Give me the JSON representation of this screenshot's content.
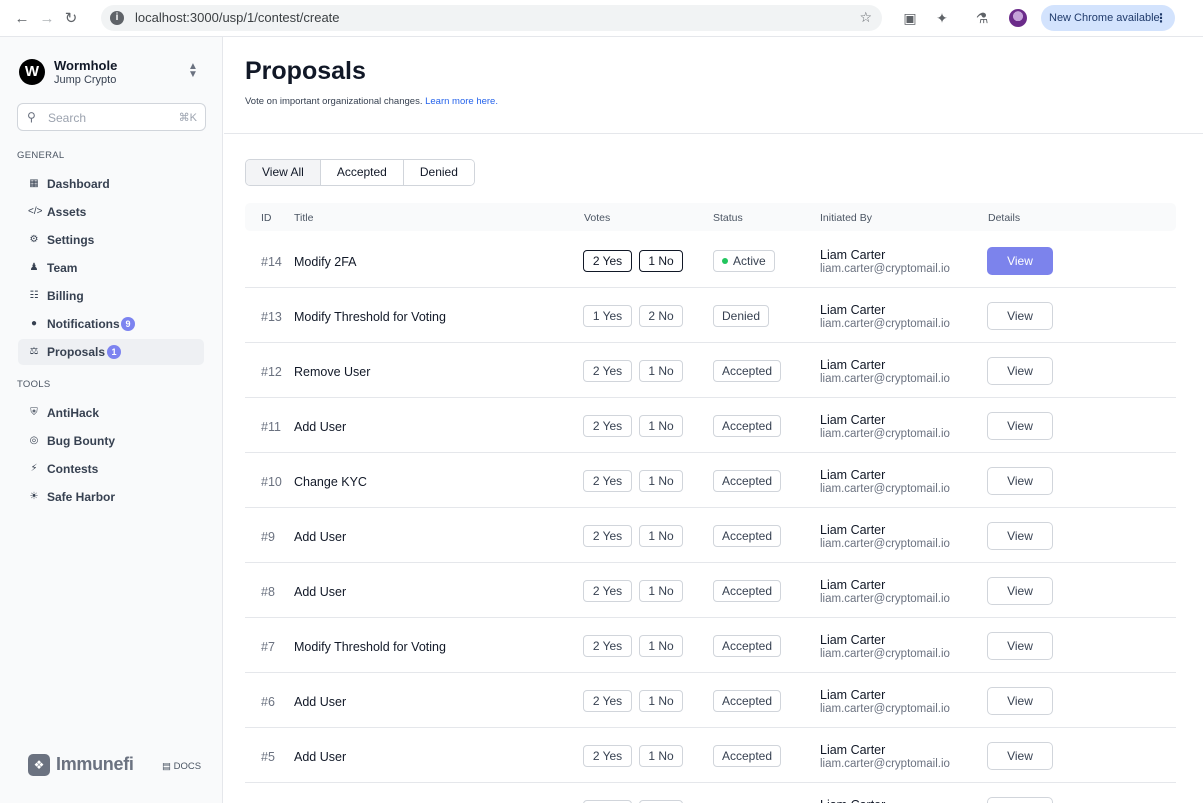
{
  "browser": {
    "url": "localhost:3000/usp/1/contest/create",
    "update_label": "New Chrome available",
    "icons": [
      "back-icon",
      "forward-icon",
      "reload-icon",
      "info-icon",
      "star-icon",
      "cast-icon",
      "extensions-icon",
      "labs-icon",
      "profile-avatar"
    ]
  },
  "org": {
    "logo_letter": "W",
    "name": "Wormhole",
    "subtitle": "Jump Crypto"
  },
  "search": {
    "placeholder": "Search",
    "shortcut": "⌘K"
  },
  "sidebar": {
    "general_label": "GENERAL",
    "tools_label": "TOOLS",
    "general_items": [
      {
        "label": "Dashboard",
        "icon": "grid-icon"
      },
      {
        "label": "Assets",
        "icon": "code-icon"
      },
      {
        "label": "Settings",
        "icon": "gear-icon"
      },
      {
        "label": "Team",
        "icon": "team-icon"
      },
      {
        "label": "Billing",
        "icon": "billing-icon"
      },
      {
        "label": "Notifications",
        "icon": "bell-icon",
        "badge": "9"
      },
      {
        "label": "Proposals",
        "icon": "scale-icon",
        "badge": "1"
      }
    ],
    "tool_items": [
      {
        "label": "AntiHack",
        "icon": "shield-icon"
      },
      {
        "label": "Bug Bounty",
        "icon": "globe-icon"
      },
      {
        "label": "Contests",
        "icon": "bolt-icon"
      },
      {
        "label": "Safe Harbor",
        "icon": "sun-icon"
      }
    ],
    "brand": "Immunefi",
    "docs": "DOCS"
  },
  "page": {
    "title": "Proposals",
    "subtitle": "Vote on important organizational changes.",
    "learn_more": "Learn more here."
  },
  "tabs": [
    "View All",
    "Accepted",
    "Denied"
  ],
  "table": {
    "headers": [
      "ID",
      "Title",
      "Votes",
      "Status",
      "Initiated By",
      "Details"
    ],
    "rows": [
      {
        "id": "#14",
        "title": "Modify 2FA",
        "yes": "2 Yes",
        "no": "1 No",
        "status": "Active",
        "name": "Liam Carter",
        "email": "liam.carter@cryptomail.io",
        "action": "View"
      },
      {
        "id": "#13",
        "title": "Modify Threshold for Voting",
        "yes": "1 Yes",
        "no": "2 No",
        "status": "Denied",
        "name": "Liam Carter",
        "email": "liam.carter@cryptomail.io",
        "action": "View"
      },
      {
        "id": "#12",
        "title": "Remove User",
        "yes": "2 Yes",
        "no": "1 No",
        "status": "Accepted",
        "name": "Liam Carter",
        "email": "liam.carter@cryptomail.io",
        "action": "View"
      },
      {
        "id": "#11",
        "title": "Add User",
        "yes": "2 Yes",
        "no": "1 No",
        "status": "Accepted",
        "name": "Liam Carter",
        "email": "liam.carter@cryptomail.io",
        "action": "View"
      },
      {
        "id": "#10",
        "title": "Change KYC",
        "yes": "2 Yes",
        "no": "1 No",
        "status": "Accepted",
        "name": "Liam Carter",
        "email": "liam.carter@cryptomail.io",
        "action": "View"
      },
      {
        "id": "#9",
        "title": "Add User",
        "yes": "2 Yes",
        "no": "1 No",
        "status": "Accepted",
        "name": "Liam Carter",
        "email": "liam.carter@cryptomail.io",
        "action": "View"
      },
      {
        "id": "#8",
        "title": "Add User",
        "yes": "2 Yes",
        "no": "1 No",
        "status": "Accepted",
        "name": "Liam Carter",
        "email": "liam.carter@cryptomail.io",
        "action": "View"
      },
      {
        "id": "#7",
        "title": "Modify Threshold for Voting",
        "yes": "2 Yes",
        "no": "1 No",
        "status": "Accepted",
        "name": "Liam Carter",
        "email": "liam.carter@cryptomail.io",
        "action": "View"
      },
      {
        "id": "#6",
        "title": "Add User",
        "yes": "2 Yes",
        "no": "1 No",
        "status": "Accepted",
        "name": "Liam Carter",
        "email": "liam.carter@cryptomail.io",
        "action": "View"
      },
      {
        "id": "#5",
        "title": "Add User",
        "yes": "2 Yes",
        "no": "1 No",
        "status": "Accepted",
        "name": "Liam Carter",
        "email": "liam.carter@cryptomail.io",
        "action": "View"
      },
      {
        "id": "",
        "title": "",
        "yes": "",
        "no": "",
        "status": "",
        "name": "Liam Carter",
        "email": "",
        "action": ""
      }
    ]
  },
  "colors": {
    "accent": "#7c83ec",
    "active_dot": "#22c55e",
    "link": "#2563eb"
  }
}
